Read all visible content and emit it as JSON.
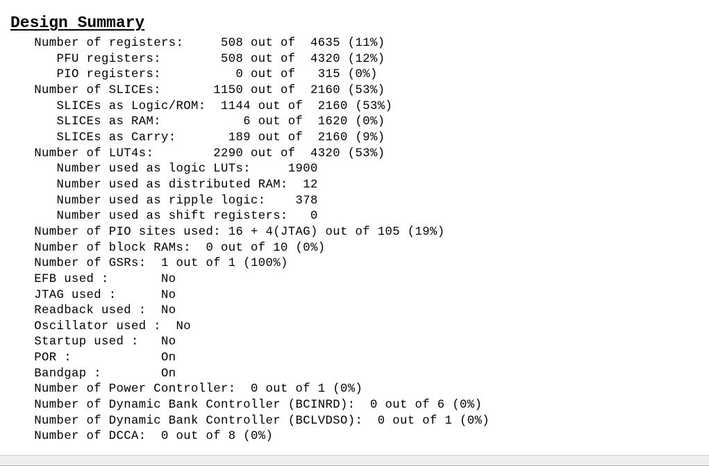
{
  "window": {
    "title": "Design Summary"
  },
  "report": {
    "title": "Design Summary",
    "lines": [
      "   Number of registers:     508 out of  4635 (11%)",
      "      PFU registers:        508 out of  4320 (12%)",
      "      PIO registers:          0 out of   315 (0%)",
      "   Number of SLICEs:       1150 out of  2160 (53%)",
      "      SLICEs as Logic/ROM:  1144 out of  2160 (53%)",
      "      SLICEs as RAM:           6 out of  1620 (0%)",
      "      SLICEs as Carry:       189 out of  2160 (9%)",
      "   Number of LUT4s:        2290 out of  4320 (53%)",
      "      Number used as logic LUTs:     1900",
      "      Number used as distributed RAM:  12",
      "      Number used as ripple logic:    378",
      "      Number used as shift registers:   0",
      "   Number of PIO sites used: 16 + 4(JTAG) out of 105 (19%)",
      "   Number of block RAMs:  0 out of 10 (0%)",
      "   Number of GSRs:  1 out of 1 (100%)",
      "   EFB used :       No",
      "   JTAG used :      No",
      "   Readback used :  No",
      "   Oscillator used :  No",
      "   Startup used :   No",
      "   POR :            On",
      "   Bandgap :        On",
      "   Number of Power Controller:  0 out of 1 (0%)",
      "   Number of Dynamic Bank Controller (BCINRD):  0 out of 6 (0%)",
      "   Number of Dynamic Bank Controller (BCLVDSO):  0 out of 1 (0%)",
      "   Number of DCCA:  0 out of 8 (0%)"
    ],
    "text": "   Number of registers:     508 out of  4635 (11%)\n      PFU registers:        508 out of  4320 (12%)\n      PIO registers:          0 out of   315 (0%)\n   Number of SLICEs:       1150 out of  2160 (53%)\n      SLICEs as Logic/ROM:  1144 out of  2160 (53%)\n      SLICEs as RAM:           6 out of  1620 (0%)\n      SLICEs as Carry:       189 out of  2160 (9%)\n   Number of LUT4s:        2290 out of  4320 (53%)\n      Number used as logic LUTs:     1900\n      Number used as distributed RAM:  12\n      Number used as ripple logic:    378\n      Number used as shift registers:   0\n   Number of PIO sites used: 16 + 4(JTAG) out of 105 (19%)\n   Number of block RAMs:  0 out of 10 (0%)\n   Number of GSRs:  1 out of 1 (100%)\n   EFB used :       No\n   JTAG used :      No\n   Readback used :  No\n   Oscillator used :  No\n   Startup used :   No\n   POR :            On\n   Bandgap :        On\n   Number of Power Controller:  0 out of 1 (0%)\n   Number of Dynamic Bank Controller (BCINRD):  0 out of 6 (0%)\n   Number of Dynamic Bank Controller (BCLVDSO):  0 out of 1 (0%)\n   Number of DCCA:  0 out of 8 (0%)",
    "entries": [
      {
        "label": "Number of registers:",
        "used": "508",
        "total": "4635",
        "percent": "11%",
        "indent": 0
      },
      {
        "label": "PFU registers:",
        "used": "508",
        "total": "4320",
        "percent": "12%",
        "indent": 1
      },
      {
        "label": "PIO registers:",
        "used": "0",
        "total": "315",
        "percent": "0%",
        "indent": 1
      },
      {
        "label": "Number of SLICEs:",
        "used": "1150",
        "total": "2160",
        "percent": "53%",
        "indent": 0
      },
      {
        "label": "SLICEs as Logic/ROM:",
        "used": "1144",
        "total": "2160",
        "percent": "53%",
        "indent": 1
      },
      {
        "label": "SLICEs as RAM:",
        "used": "6",
        "total": "1620",
        "percent": "0%",
        "indent": 1
      },
      {
        "label": "SLICEs as Carry:",
        "used": "189",
        "total": "2160",
        "percent": "9%",
        "indent": 1
      },
      {
        "label": "Number of LUT4s:",
        "used": "2290",
        "total": "4320",
        "percent": "53%",
        "indent": 0
      },
      {
        "label": "Number used as logic LUTs:",
        "used": "1900",
        "total": "",
        "percent": "",
        "indent": 1
      },
      {
        "label": "Number used as distributed RAM:",
        "used": "12",
        "total": "",
        "percent": "",
        "indent": 1
      },
      {
        "label": "Number used as ripple logic:",
        "used": "378",
        "total": "",
        "percent": "",
        "indent": 1
      },
      {
        "label": "Number used as shift registers:",
        "used": "0",
        "total": "",
        "percent": "",
        "indent": 1
      },
      {
        "label": "Number of PIO sites used:",
        "used": "16 + 4(JTAG)",
        "total": "105",
        "percent": "19%",
        "indent": 0
      },
      {
        "label": "Number of block RAMs:",
        "used": "0",
        "total": "10",
        "percent": "0%",
        "indent": 0
      },
      {
        "label": "Number of GSRs:",
        "used": "1",
        "total": "1",
        "percent": "100%",
        "indent": 0
      },
      {
        "label": "EFB used :",
        "used": "No",
        "total": "",
        "percent": "",
        "indent": 0
      },
      {
        "label": "JTAG used :",
        "used": "No",
        "total": "",
        "percent": "",
        "indent": 0
      },
      {
        "label": "Readback used :",
        "used": "No",
        "total": "",
        "percent": "",
        "indent": 0
      },
      {
        "label": "Oscillator used :",
        "used": "No",
        "total": "",
        "percent": "",
        "indent": 0
      },
      {
        "label": "Startup used :",
        "used": "No",
        "total": "",
        "percent": "",
        "indent": 0
      },
      {
        "label": "POR :",
        "used": "On",
        "total": "",
        "percent": "",
        "indent": 0
      },
      {
        "label": "Bandgap :",
        "used": "On",
        "total": "",
        "percent": "",
        "indent": 0
      },
      {
        "label": "Number of Power Controller:",
        "used": "0",
        "total": "1",
        "percent": "0%",
        "indent": 0
      },
      {
        "label": "Number of Dynamic Bank Controller (BCINRD):",
        "used": "0",
        "total": "6",
        "percent": "0%",
        "indent": 0
      },
      {
        "label": "Number of Dynamic Bank Controller (BCLVDSO):",
        "used": "0",
        "total": "1",
        "percent": "0%",
        "indent": 0
      },
      {
        "label": "Number of DCCA:",
        "used": "0",
        "total": "8",
        "percent": "0%",
        "indent": 0
      }
    ]
  },
  "colors": {
    "page_background": "#ffffff",
    "text": "#000000",
    "bottom_bar": "#efefef",
    "bottom_bar_border": "#b4b4b4",
    "edge_rule": "#d9d9d9"
  }
}
